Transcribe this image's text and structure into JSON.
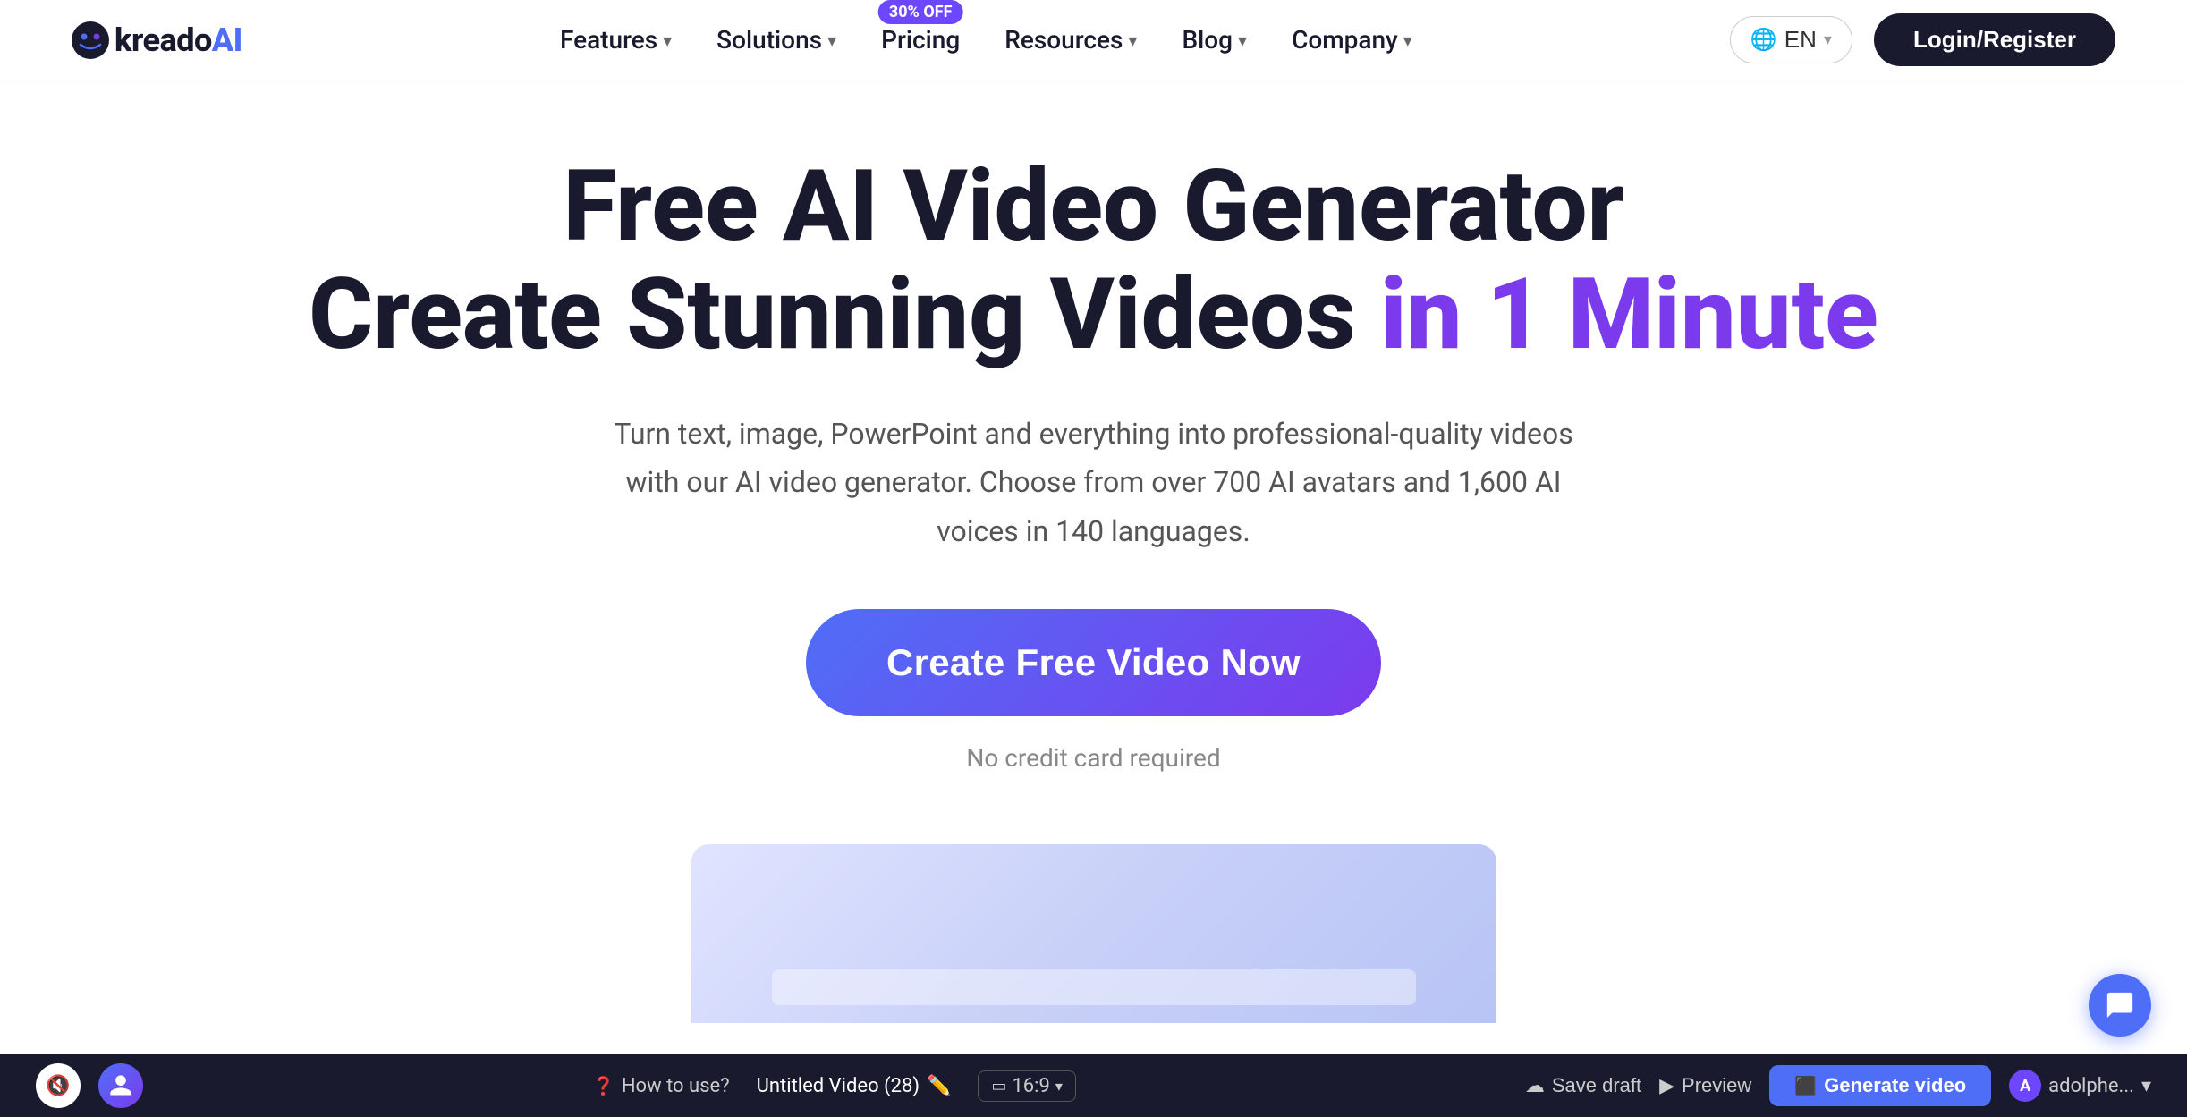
{
  "logo": {
    "text": "kreadoAI",
    "kreado_part": "kreado",
    "ai_part": "AI"
  },
  "nav": {
    "features_label": "Features",
    "solutions_label": "Solutions",
    "pricing_label": "Pricing",
    "pricing_badge": "30% OFF",
    "resources_label": "Resources",
    "blog_label": "Blog",
    "company_label": "Company",
    "lang_label": "EN",
    "login_label": "Login/Register"
  },
  "hero": {
    "title_line1": "Free AI Video Generator",
    "title_line2_plain": "Create Stunning Videos",
    "title_line2_accent": "in 1 Minute",
    "subtitle": "Turn text, image, PowerPoint and everything into professional-quality videos with our AI video generator. Choose from over 700 AI avatars and 1,600 AI voices in 140 languages.",
    "cta_label": "Create Free Video Now",
    "no_credit": "No credit card required"
  },
  "bottom_bar": {
    "how_to": "How to use?",
    "video_title": "Untitled Video (28)",
    "aspect_ratio": "16:9",
    "save_draft": "Save draft",
    "preview": "Preview",
    "generate": "Generate video",
    "user": "adolphe..."
  },
  "colors": {
    "accent_purple": "#7c3aed",
    "accent_blue": "#4f6ef7",
    "dark": "#1a1a2e",
    "badge_bg": "#6c47ff"
  }
}
